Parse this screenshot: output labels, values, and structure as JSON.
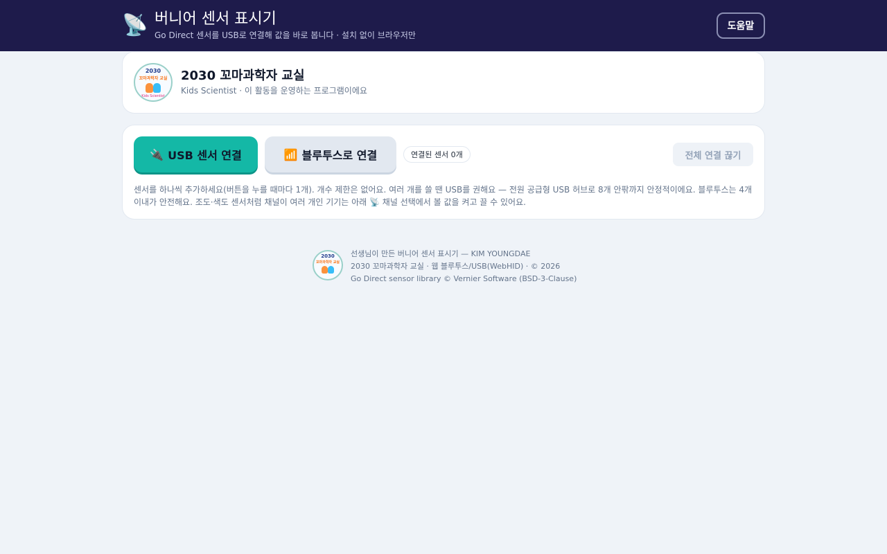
{
  "header": {
    "icon": "satellite-dish-icon",
    "icon_glyph": "📡",
    "title": "버니어 센서 표시기",
    "subtitle": "Go Direct 센서를 USB로 연결해 값을 바로 봅니다 · 설치 없이 브라우저만",
    "help_label": "도움말"
  },
  "org": {
    "logo_year": "2030",
    "logo_text": "꼬마과학자 교실",
    "logo_tag": "Kids Scientist",
    "title": "2030 꼬마과학자 교실",
    "subtitle": "Kids Scientist · 이 활동을 운영하는 프로그램이에요"
  },
  "connection": {
    "usb_icon": "🔌",
    "usb_label": "USB 센서 연결",
    "ble_icon": "📶",
    "ble_label": "블루투스로 연결",
    "count_label": "연결된 센서 0개",
    "disconnect_label": "전체 연결 끊기",
    "help_text": "센서를 하나씩 추가하세요(버튼을 누를 때마다 1개). 개수 제한은 없어요. 여러 개를 쓸 땐 USB를 권해요 — 전원 공급형 USB 허브로 8개 안팎까지 안정적이에요. 블루투스는 4개 이내가 안전해요. 조도·색도 센서처럼 채널이 여러 개인 기기는 아래 📡 채널 선택에서 볼 값을 켜고 끌 수 있어요."
  },
  "footer": {
    "line1": "선생님이 만든 버니어 센서 표시기 — KIM YOUNGDAE",
    "line2": "2030 꼬마과학자 교실 · 웹 블루투스/USB(WebHID) · © 2026",
    "line3": "Go Direct sensor library © Vernier Software (BSD-3-Clause)"
  },
  "colors": {
    "header_bg": "#1e1b4b",
    "accent": "#14b8a6",
    "page_bg": "#eff3f8"
  }
}
